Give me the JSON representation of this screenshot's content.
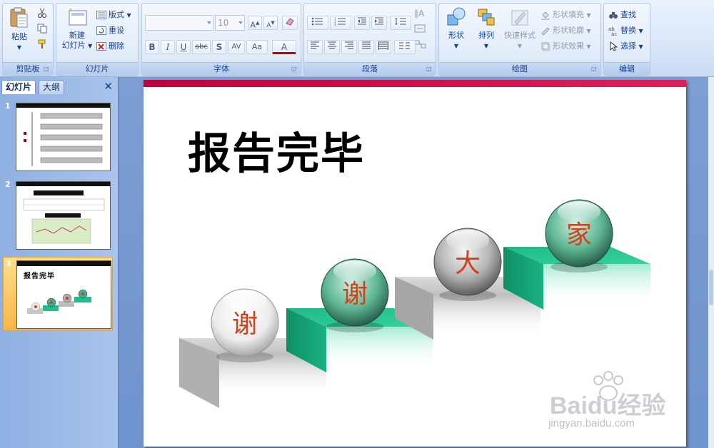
{
  "ribbon": {
    "clipboard": {
      "label": "剪贴板",
      "paste": "粘贴"
    },
    "slides": {
      "label": "幻灯片",
      "new_slide_line1": "新建",
      "new_slide_line2": "幻灯片",
      "layout": "版式",
      "reset": "重设",
      "delete": "删除"
    },
    "font": {
      "label": "字体",
      "font_name": "",
      "font_size": "10",
      "bold": "B",
      "italic": "I",
      "underline": "U",
      "strike": "abc",
      "shadow": "S",
      "spacing": "AV",
      "case": "Aa",
      "color": "A"
    },
    "paragraph": {
      "label": "段落"
    },
    "drawing": {
      "label": "绘图",
      "shapes": "形状",
      "arrange": "排列",
      "quick_styles": "快速样式",
      "shape_fill": "形状填充",
      "shape_outline": "形状轮廓",
      "shape_effects": "形状效果"
    },
    "editing": {
      "label": "编辑",
      "find": "查找",
      "replace": "替换",
      "select": "选择"
    }
  },
  "pane": {
    "tab_slides": "幻灯片",
    "tab_outline": "大纲",
    "thumbnails": [
      {
        "number": "1"
      },
      {
        "number": "2"
      },
      {
        "number": "3",
        "title": "报告完毕"
      }
    ]
  },
  "slide": {
    "title": "报告完毕",
    "balls": [
      "谢",
      "谢",
      "大",
      "家"
    ],
    "colors": {
      "accent_bar": "#d4003f",
      "green": "#1fc08e",
      "gray": "#c6c6c6",
      "char": "#d4401a"
    }
  },
  "watermark": {
    "text": "Baidu经验",
    "url": "jingyan.baidu.com"
  }
}
